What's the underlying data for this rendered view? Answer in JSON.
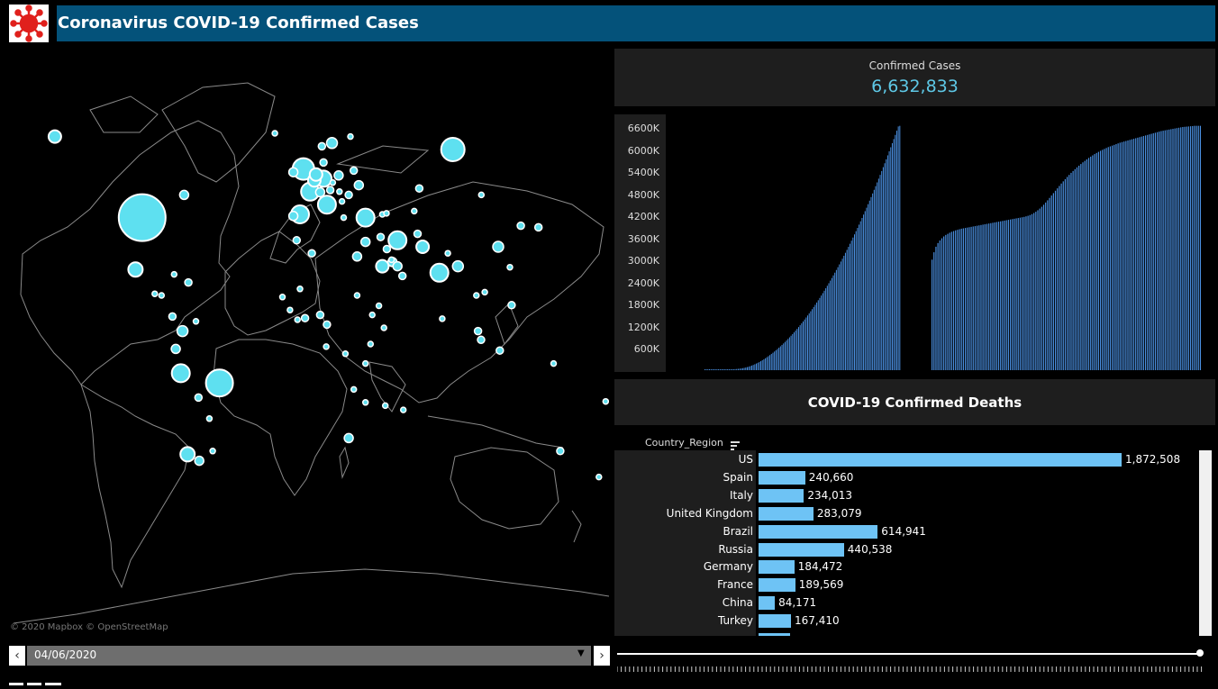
{
  "header": {
    "title": "Coronavirus COVID-19 Confirmed Cases",
    "logo_icon": "virus-icon"
  },
  "map": {
    "attribution": "© 2020 Mapbox  © OpenStreetMap",
    "bubble_color": "#5ee0f0",
    "bubbles": [
      {
        "name": "US",
        "lon": -98,
        "lat": 39,
        "r": 26
      },
      {
        "name": "Russia",
        "lon": 87,
        "lat": 60,
        "r": 13
      },
      {
        "name": "Brazil",
        "lon": -52,
        "lat": -12,
        "r": 15
      },
      {
        "name": "Alaska",
        "lon": -150,
        "lat": 64,
        "r": 7
      },
      {
        "name": "Mexico",
        "lon": -102,
        "lat": 23,
        "r": 8
      },
      {
        "name": "Peru",
        "lon": -75,
        "lat": -9,
        "r": 10
      },
      {
        "name": "Chile",
        "lon": -71,
        "lat": -34,
        "r": 8
      },
      {
        "name": "Colombia",
        "lon": -74,
        "lat": 4,
        "r": 6
      },
      {
        "name": "Argentina",
        "lon": -64,
        "lat": -36,
        "r": 5
      },
      {
        "name": "Spain",
        "lon": -4,
        "lat": 40,
        "r": 10
      },
      {
        "name": "France",
        "lon": 2,
        "lat": 47,
        "r": 10
      },
      {
        "name": "UK",
        "lon": -2,
        "lat": 54,
        "r": 12
      },
      {
        "name": "Italy",
        "lon": 12,
        "lat": 43,
        "r": 10
      },
      {
        "name": "Germany",
        "lon": 10,
        "lat": 51,
        "r": 9
      },
      {
        "name": "Belgium",
        "lon": 4.5,
        "lat": 50.5,
        "r": 7
      },
      {
        "name": "Netherlands",
        "lon": 5.5,
        "lat": 52.3,
        "r": 7
      },
      {
        "name": "Turkey",
        "lon": 35,
        "lat": 39,
        "r": 10
      },
      {
        "name": "Iran",
        "lon": 54,
        "lat": 32,
        "r": 10
      },
      {
        "name": "India",
        "lon": 79,
        "lat": 22,
        "r": 10
      },
      {
        "name": "Pakistan",
        "lon": 69,
        "lat": 30,
        "r": 7
      },
      {
        "name": "Saudi Arabia",
        "lon": 45,
        "lat": 24,
        "r": 7
      },
      {
        "name": "China",
        "lon": 114,
        "lat": 30,
        "r": 6
      },
      {
        "name": "Sweden",
        "lon": 15,
        "lat": 62,
        "r": 6
      },
      {
        "name": "Egypt",
        "lon": 30,
        "lat": 27,
        "r": 5
      },
      {
        "name": "South Africa",
        "lon": 25,
        "lat": -29,
        "r": 5
      },
      {
        "name": "Bangladesh",
        "lon": 90,
        "lat": 24,
        "r": 6
      },
      {
        "name": "Ecuador",
        "lon": -78,
        "lat": -1.5,
        "r": 5
      },
      {
        "name": "Indonesia",
        "lon": 115,
        "lat": -2,
        "r": 4
      },
      {
        "name": "Japan",
        "lon": 138,
        "lat": 36,
        "r": 4
      },
      {
        "name": "Poland",
        "lon": 19,
        "lat": 52,
        "r": 5
      },
      {
        "name": "Ukraine",
        "lon": 31,
        "lat": 49,
        "r": 5
      },
      {
        "name": "Portugal",
        "lon": -8,
        "lat": 39.5,
        "r": 5
      },
      {
        "name": "Belarus",
        "lon": 28,
        "lat": 53.5,
        "r": 4
      },
      {
        "name": "Qatar",
        "lon": 51,
        "lat": 25.3,
        "r": 5
      },
      {
        "name": "Singapore",
        "lon": 103.8,
        "lat": 1.3,
        "r": 4
      },
      {
        "name": "Philippines",
        "lon": 122,
        "lat": 12,
        "r": 4
      },
      {
        "name": "Canada East",
        "lon": -73,
        "lat": 46,
        "r": 5
      },
      {
        "name": "Switzerland",
        "lon": 8,
        "lat": 46.8,
        "r": 5
      },
      {
        "name": "Austria",
        "lon": 14,
        "lat": 47.5,
        "r": 4
      },
      {
        "name": "Ireland",
        "lon": -8,
        "lat": 53,
        "r": 5
      },
      {
        "name": "Norway",
        "lon": 9,
        "lat": 61,
        "r": 4
      },
      {
        "name": "Denmark",
        "lon": 10,
        "lat": 56,
        "r": 4
      },
      {
        "name": "Romania",
        "lon": 25,
        "lat": 46,
        "r": 4
      },
      {
        "name": "Israel",
        "lon": 35,
        "lat": 31.5,
        "r": 5
      },
      {
        "name": "UAE",
        "lon": 54,
        "lat": 24,
        "r": 5
      },
      {
        "name": "Kuwait",
        "lon": 47.7,
        "lat": 29.3,
        "r": 4
      },
      {
        "name": "Iraq",
        "lon": 44,
        "lat": 33,
        "r": 4
      },
      {
        "name": "Afghanistan",
        "lon": 66,
        "lat": 34,
        "r": 4
      },
      {
        "name": "Kazakhstan",
        "lon": 67,
        "lat": 48,
        "r": 4
      },
      {
        "name": "South Korea",
        "lon": 127.5,
        "lat": 36.5,
        "r": 4
      },
      {
        "name": "Malaysia",
        "lon": 102,
        "lat": 4,
        "r": 4
      },
      {
        "name": "Thailand",
        "lon": 101,
        "lat": 15,
        "r": 3
      },
      {
        "name": "Vietnam",
        "lon": 106,
        "lat": 16,
        "r": 3
      },
      {
        "name": "Australia",
        "lon": 151,
        "lat": -33,
        "r": 4
      },
      {
        "name": "New Zealand",
        "lon": 174,
        "lat": -41,
        "r": 3
      },
      {
        "name": "Nigeria",
        "lon": 8,
        "lat": 9,
        "r": 4
      },
      {
        "name": "Ghana",
        "lon": -1,
        "lat": 8,
        "r": 4
      },
      {
        "name": "Cameroon",
        "lon": 12,
        "lat": 6,
        "r": 4
      },
      {
        "name": "Morocco",
        "lon": -6,
        "lat": 32,
        "r": 4
      },
      {
        "name": "Algeria",
        "lon": 3,
        "lat": 28,
        "r": 4
      },
      {
        "name": "Senegal",
        "lon": -14.5,
        "lat": 14.5,
        "r": 3
      },
      {
        "name": "Ethiopia",
        "lon": 39,
        "lat": 9,
        "r": 3
      },
      {
        "name": "Kenya",
        "lon": 38,
        "lat": 0,
        "r": 3
      },
      {
        "name": "Sudan",
        "lon": 30,
        "lat": 15,
        "r": 3
      },
      {
        "name": "DR Congo",
        "lon": 23,
        "lat": -3,
        "r": 3
      },
      {
        "name": "Madagascar",
        "lon": 46.8,
        "lat": -19,
        "r": 3
      },
      {
        "name": "Dominican Rep",
        "lon": -70.5,
        "lat": 19,
        "r": 4
      },
      {
        "name": "Panama",
        "lon": -80,
        "lat": 8.5,
        "r": 4
      },
      {
        "name": "Guatemala",
        "lon": -90.5,
        "lat": 15.5,
        "r": 3
      },
      {
        "name": "Honduras",
        "lon": -86.5,
        "lat": 15,
        "r": 3
      },
      {
        "name": "Cuba",
        "lon": -79,
        "lat": 21.5,
        "r": 3
      },
      {
        "name": "Venezuela",
        "lon": -66,
        "lat": 7,
        "r": 3
      },
      {
        "name": "Bolivia",
        "lon": -64.5,
        "lat": -16.5,
        "r": 4
      },
      {
        "name": "Paraguay",
        "lon": -58,
        "lat": -23,
        "r": 3
      },
      {
        "name": "Uruguay",
        "lon": -56,
        "lat": -33,
        "r": 3
      },
      {
        "name": "Greece",
        "lon": 22,
        "lat": 39,
        "r": 3
      },
      {
        "name": "Serbia",
        "lon": 21,
        "lat": 44,
        "r": 3
      },
      {
        "name": "Hungary",
        "lon": 19.5,
        "lat": 47,
        "r": 3
      },
      {
        "name": "Czechia",
        "lon": 15.5,
        "lat": 49.8,
        "r": 3
      },
      {
        "name": "Finland",
        "lon": 26,
        "lat": 64,
        "r": 3
      },
      {
        "name": "Iceland",
        "lon": -19,
        "lat": 65,
        "r": 3
      },
      {
        "name": "Oman",
        "lon": 57,
        "lat": 21,
        "r": 4
      },
      {
        "name": "Bahrain",
        "lon": 50.5,
        "lat": 26,
        "r": 3
      },
      {
        "name": "Armenia",
        "lon": 45,
        "lat": 40,
        "r": 3
      },
      {
        "name": "Azerbaijan",
        "lon": 47.5,
        "lat": 40.3,
        "r": 3
      },
      {
        "name": "Uzbekistan",
        "lon": 64,
        "lat": 41,
        "r": 3
      },
      {
        "name": "Nepal",
        "lon": 84,
        "lat": 28,
        "r": 3
      },
      {
        "name": "Sri Lanka",
        "lon": 80.7,
        "lat": 7.8,
        "r": 3
      },
      {
        "name": "Taiwan",
        "lon": 121,
        "lat": 23.7,
        "r": 3
      },
      {
        "name": "Mongolia",
        "lon": 104,
        "lat": 46,
        "r": 3
      },
      {
        "name": "Ivory Coast",
        "lon": -5.5,
        "lat": 7.5,
        "r": 3
      },
      {
        "name": "Guinea",
        "lon": -10,
        "lat": 10.5,
        "r": 3
      },
      {
        "name": "Mali",
        "lon": -4,
        "lat": 17,
        "r": 3
      },
      {
        "name": "Gabon",
        "lon": 11.6,
        "lat": -0.8,
        "r": 3
      },
      {
        "name": "Zambia",
        "lon": 28,
        "lat": -14,
        "r": 3
      },
      {
        "name": "Mozambique",
        "lon": 35,
        "lat": -18,
        "r": 3
      },
      {
        "name": "Tanzania",
        "lon": 35,
        "lat": -6,
        "r": 3
      },
      {
        "name": "Somalia",
        "lon": 46,
        "lat": 5,
        "r": 3
      },
      {
        "name": "Djibouti",
        "lon": 43,
        "lat": 11.8,
        "r": 3
      },
      {
        "name": "Mauritius",
        "lon": 57.5,
        "lat": -20.3,
        "r": 3
      },
      {
        "name": "Fiji",
        "lon": 178,
        "lat": -17.7,
        "r": 3
      },
      {
        "name": "PNG",
        "lon": 147,
        "lat": -6,
        "r": 3
      }
    ]
  },
  "kpi": {
    "label": "Confirmed Cases",
    "value": "6,632,833"
  },
  "cases_chart": {
    "bar_color": "#4a8fe0",
    "y_ticks": [
      "6600K",
      "6000K",
      "5400K",
      "4800K",
      "4200K",
      "3600K",
      "3000K",
      "2400K",
      "1800K",
      "1200K",
      "600K"
    ],
    "chart_data": {
      "type": "bar",
      "ylim": [
        0,
        6600000
      ],
      "series": [
        {
          "values_in_k": [
            2,
            2,
            3,
            3,
            4,
            4,
            5,
            6,
            7,
            8,
            9,
            10,
            11,
            12,
            14,
            16,
            18,
            20,
            22,
            25,
            28,
            32,
            36,
            41,
            47,
            54,
            62,
            72,
            83,
            95,
            109,
            125,
            142,
            160,
            180,
            200,
            222,
            245,
            270,
            296,
            323,
            351,
            380,
            410,
            441,
            473,
            506,
            540,
            575,
            611,
            648,
            686,
            725,
            765,
            806,
            848,
            891,
            935,
            980,
            1026,
            1073,
            1121,
            1170,
            1220,
            1271,
            1323,
            1376,
            1430,
            1485,
            1541,
            1598,
            1656,
            1715,
            1775,
            1836,
            1898,
            1961,
            2025,
            2090,
            2156,
            2223,
            2291,
            2360,
            2430,
            2501,
            2573,
            2646,
            2720,
            2795,
            2871,
            2948,
            3026,
            3105,
            3185,
            3266,
            3348,
            3431,
            3515,
            3600,
            3686,
            3773,
            3861,
            3950,
            4040,
            4131,
            4223,
            4316,
            4410,
            4505,
            4601,
            4698,
            4796,
            4895,
            4995,
            5096,
            5198,
            5301,
            5405,
            5510,
            5616,
            5723,
            5831,
            5940,
            6050,
            6161,
            6273,
            6386,
            6500,
            6615,
            6632
          ]
        },
        {
          "values_in_k": [
            3000,
            3200,
            3350,
            3450,
            3520,
            3580,
            3630,
            3670,
            3700,
            3730,
            3755,
            3775,
            3795,
            3810,
            3825,
            3840,
            3850,
            3860,
            3870,
            3880,
            3890,
            3900,
            3910,
            3920,
            3930,
            3940,
            3950,
            3960,
            3970,
            3980,
            3990,
            4000,
            4010,
            4020,
            4030,
            4040,
            4050,
            4060,
            4070,
            4080,
            4090,
            4100,
            4110,
            4120,
            4130,
            4140,
            4150,
            4160,
            4175,
            4190,
            4210,
            4235,
            4265,
            4300,
            4340,
            4385,
            4435,
            4490,
            4550,
            4610,
            4675,
            4740,
            4805,
            4870,
            4935,
            5000,
            5065,
            5125,
            5185,
            5245,
            5300,
            5355,
            5405,
            5455,
            5505,
            5550,
            5595,
            5640,
            5680,
            5720,
            5760,
            5795,
            5830,
            5865,
            5895,
            5925,
            5955,
            5980,
            6005,
            6030,
            6055,
            6075,
            6095,
            6115,
            6135,
            6155,
            6175,
            6190,
            6205,
            6220,
            6235,
            6250,
            6265,
            6280,
            6295,
            6310,
            6325,
            6340,
            6355,
            6370,
            6385,
            6400,
            6415,
            6430,
            6445,
            6460,
            6475,
            6490,
            6500,
            6510,
            6520,
            6530,
            6540,
            6550,
            6560,
            6570,
            6580,
            6590,
            6600,
            6605,
            6610,
            6615,
            6620,
            6625,
            6632,
            6632,
            6632,
            6632
          ]
        }
      ]
    }
  },
  "deaths": {
    "title": "COVID-19 Confirmed Deaths",
    "column_header": "Country_Region",
    "bar_color": "#6ec3f5",
    "max_value": 1872508,
    "rows": [
      {
        "label": "US",
        "value": 1872508,
        "text": "1,872,508"
      },
      {
        "label": "Spain",
        "value": 240660,
        "text": "240,660"
      },
      {
        "label": "Italy",
        "value": 234013,
        "text": "234,013"
      },
      {
        "label": "United Kingdom",
        "value": 283079,
        "text": "283,079"
      },
      {
        "label": "Brazil",
        "value": 614941,
        "text": "614,941"
      },
      {
        "label": "Russia",
        "value": 440538,
        "text": "440,538"
      },
      {
        "label": "Germany",
        "value": 184472,
        "text": "184,472"
      },
      {
        "label": "France",
        "value": 189569,
        "text": "189,569"
      },
      {
        "label": "China",
        "value": 84171,
        "text": "84,171"
      },
      {
        "label": "Turkey",
        "value": 167410,
        "text": "167,410"
      }
    ]
  },
  "filter": {
    "date": "04/06/2020",
    "prev_icon": "chevron-left-icon",
    "next_icon": "chevron-right-icon"
  },
  "slider": {
    "position": 1.0
  }
}
